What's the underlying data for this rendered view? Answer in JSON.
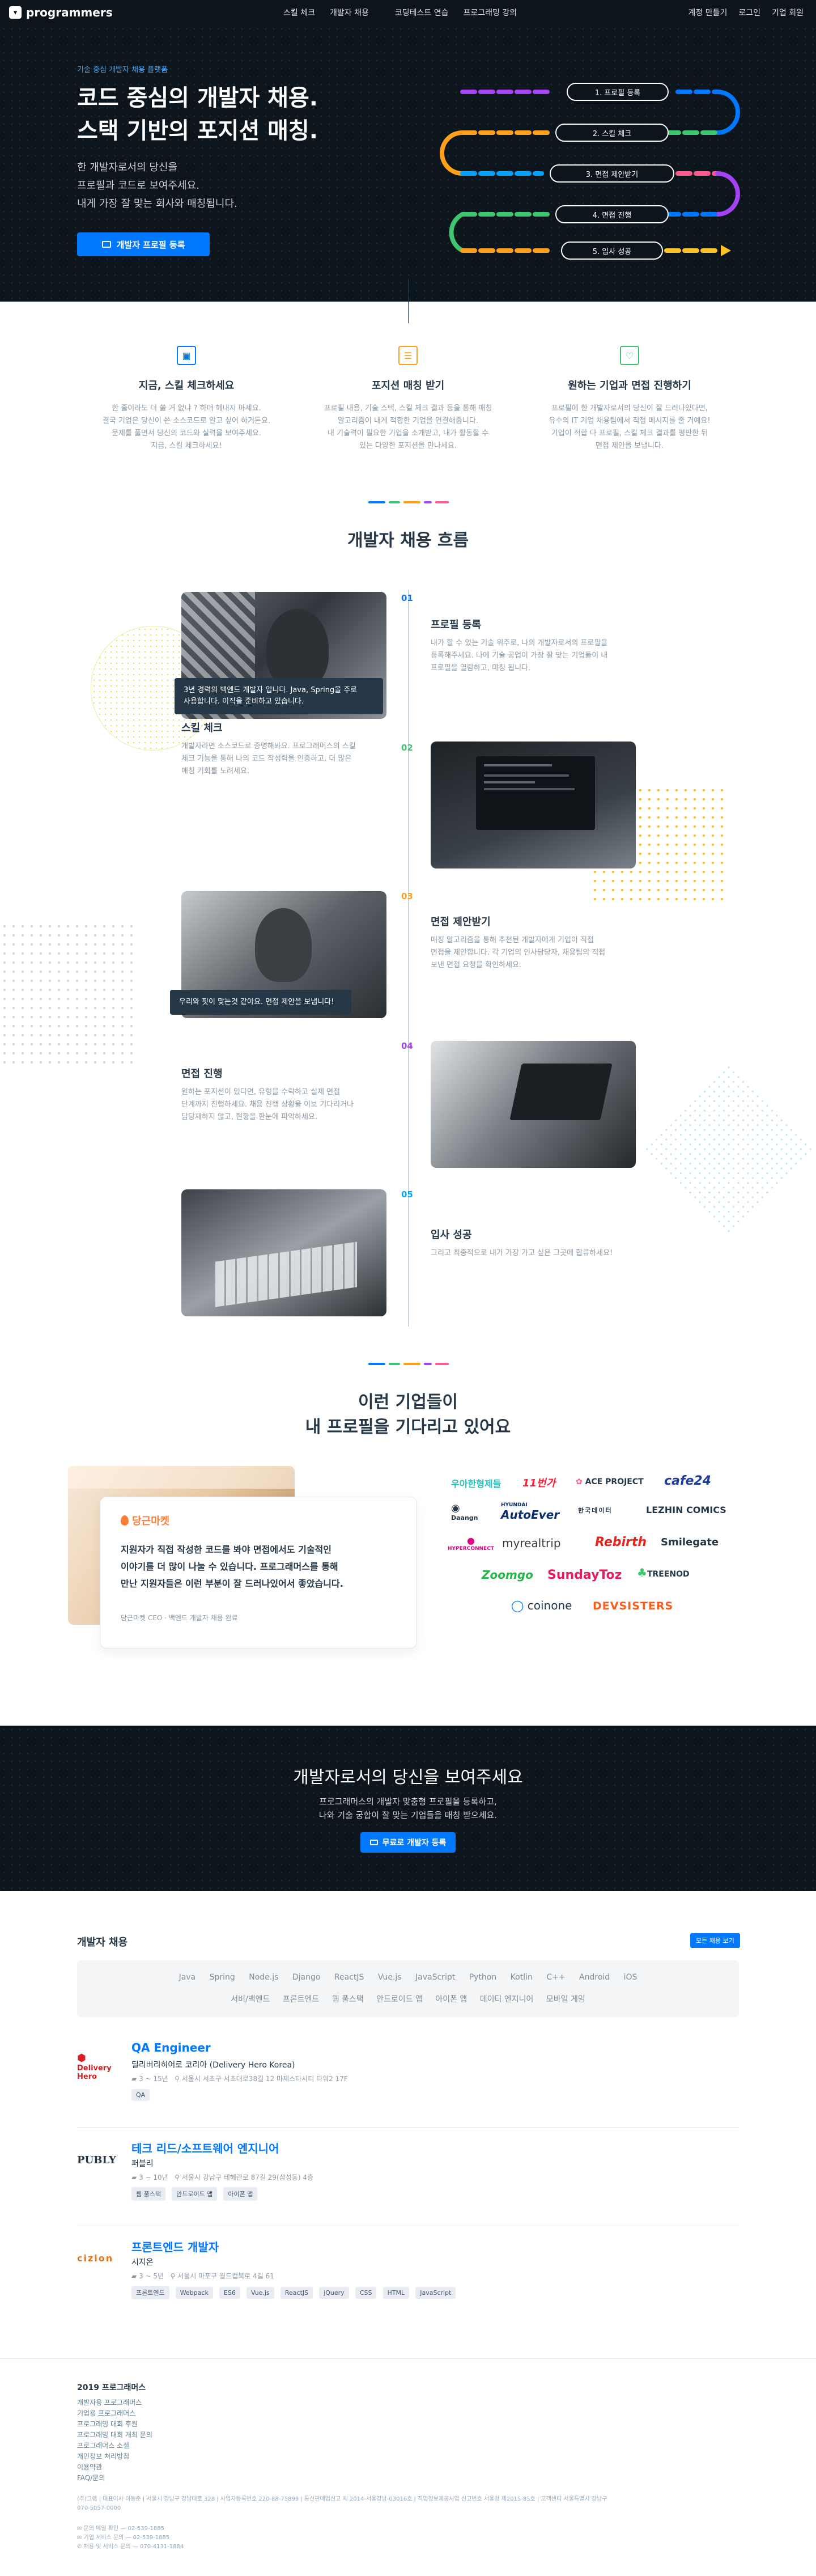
{
  "nav": {
    "brand": "programmers",
    "center_links": [
      "스킬 체크",
      "개발자 채용",
      "코딩테스트 연습",
      "프로그래밍 강의"
    ],
    "right_links": [
      "계정 만들기",
      "로그인",
      "기업 회원"
    ]
  },
  "hero": {
    "eyebrow": "기술 중심 개발자 채용 플랫폼",
    "title_line1": "코드 중심의 개발자 채용.",
    "title_line2": "스택 기반의 포지션 매칭.",
    "desc_line1": "한 개발자로서의 당신을",
    "desc_line2": "프로필과 코드로 보여주세요.",
    "desc_line3": "내게 가장 잘 맞는 회사와 매칭됩니다.",
    "cta": "개발자 프로필 등록",
    "flow_steps": [
      "1. 프로필 등록",
      "2. 스킬 체크",
      "3. 면접 제안받기",
      "4. 면접 진행",
      "5. 입사 성공"
    ]
  },
  "features": [
    {
      "title": "지금, 스킬 체크하세요",
      "icon": "skill-check-icon",
      "color": "#0078ff",
      "lines": [
        "한 줄이라도 더 쓸 거 없냐 ? 하며 헤내지 마세요.",
        "결국 기업은 당신이 쓴 소스코드로 알고 싶어 하거든요.",
        "문제를 풀면서 당신의 코드와 실력을 보여주세요.",
        "지금, 스킬 체크하세요!"
      ]
    },
    {
      "title": "포지션 매칭 받기",
      "icon": "position-match-icon",
      "color": "#ff9f1a",
      "lines": [
        "프로필 내용, 기술 스택, 스킬 체크 결과 등을 통해 매칭",
        "알고리즘이 내게 적합한 기업을 연결해줍니다.",
        "내 기술력이 필요한 기업을 소개받고, 내가 활동할 수",
        "있는 다양한 포지션을 만나세요."
      ]
    },
    {
      "title": "원하는 기업과 면접 진행하기",
      "icon": "interview-icon",
      "color": "#3ec56f",
      "lines": [
        "프로필에 한 개발자로서의 당신이 잘 드러나있다면,",
        "유수의 IT 기업 채용팀에서 직접 메시지를 줄 거예요!",
        "기업이 적합 다 프로필, 스킬 체크 결과를 평판한 뒤",
        "면접 제안을 보냅니다."
      ]
    }
  ],
  "flow_section": {
    "title": "개발자 채용 흐름",
    "steps": [
      {
        "num": "01",
        "title": "프로필 등록",
        "color": "#0078ff",
        "lines": [
          "내가 할 수 있는 기술 위주로, 나의 개발자로서의 프로필을",
          "등록해주세요. 나에 기술 공업이 가장 잘 맞는 기업들이 내",
          "프로필을 열람하고, 먀칭 됩니다."
        ],
        "caption_line1": "3년 경력의 백엔드 개발자 입니다. Java, Spring을 주로",
        "caption_line2": "사용합니다. 이직을 준비하고 있습니다."
      },
      {
        "num": "02",
        "title": "스킬 체크",
        "color": "#3ec56f",
        "lines": [
          "개발자라면 소스코드로 증명해봐요. 프로그래머스의 스킬",
          "체크 기능을 통해 나의 코드 작성력을 인증하고, 더 많은",
          "매칭 기회를 노려세요."
        ]
      },
      {
        "num": "03",
        "title": "면접 제안받기",
        "color": "#ff9f1a",
        "lines": [
          "매칭 알고리즘을 통해 추천된 개발자에게 기업이 직접",
          "면접을 제안합니다. 각 기업의 인사담당자, 채용팀의 직접",
          "보낸 면접 요청을 확인하세요."
        ],
        "caption_line1": "우리와 핏이 맞는것 같아요. 면접 제안을 보냅니다!"
      },
      {
        "num": "04",
        "title": "면접 진행",
        "color": "#a442f4",
        "lines": [
          "원하는 포지션이 있다면, 유형을 수락하고 실제 면접",
          "단계까지 진행하세요. 채용 진행 상황을 이보 기다리거나",
          "담당재하지 않고, 현황을 한눈에 파악하세요."
        ]
      },
      {
        "num": "05",
        "title": "입사 성공",
        "color": "#00a5ff",
        "lines": [
          "그리고 최종적으로 내가 가장 가고 싶은 그곳에 합류하세요!"
        ]
      }
    ]
  },
  "companies_section": {
    "title_line1": "이런 기업들이",
    "title_line2": "내 프로필을 기다리고 있어요",
    "quote_company": "당근마켓",
    "quote_line1": "지원자가 직접 작성한 코드를 봐야 면접에서도 기술적인",
    "quote_line2": "이야기를 더 많이 나눌 수 있습니다. 프로그래머스를 통해",
    "quote_line3": "만난 지원자들은 이런 부분이 잘 드러나있어서 좋았습니다.",
    "quote_author": "당근마켓 CEO  ·  백엔드 개발자 채용 완료",
    "logos": [
      {
        "text": "우아한형제들",
        "color": "#2ac1bc"
      },
      {
        "text": "11번가",
        "color": "#ff1e36"
      },
      {
        "text": "ACE PROJECT",
        "color": "#263747"
      },
      {
        "text": "cafe24",
        "color": "#1d3f99"
      },
      {
        "text": "Daangn",
        "color": "#263747"
      },
      {
        "text": "AutoEver",
        "color": "#0a2d6b"
      },
      {
        "text": "한국데이터",
        "color": "#263747"
      },
      {
        "text": "LEZHIN COMICS",
        "color": "#263747"
      },
      {
        "text": "HYPERCONNECT",
        "color": "#e4007f"
      },
      {
        "text": "myrealtrip",
        "color": "#3a3a3a"
      },
      {
        "text": "Rebirth",
        "color": "#e4231f"
      },
      {
        "text": "Smilegate",
        "color": "#263747"
      },
      {
        "text": "Zoomgo",
        "color": "#25b34a"
      },
      {
        "text": "SundayToz",
        "color": "#e31d5e"
      },
      {
        "text": "TREENOD",
        "color": "#263747"
      },
      {
        "text": "coinone",
        "color": "#263747"
      },
      {
        "text": "DEVSISTERS",
        "color": "#ff5a1a"
      }
    ]
  },
  "cta_band": {
    "title": "개발자로서의 당신을 보여주세요",
    "desc_line1": "프로그래머스의 개발자 맞춤형 프로필을 등록하고,",
    "desc_line2": "나와 기술 궁합이 잘 맞는 기업들을 매칭 받으세요.",
    "button": "무료로 개발자 등록"
  },
  "jobs": {
    "section_title": "개발자 채용",
    "view_all": "모든 채용 보기",
    "filters_row1": [
      "Java",
      "Spring",
      "Node.js",
      "Django",
      "ReactJS",
      "Vue.js",
      "JavaScript",
      "Python",
      "Kotlin",
      "C++",
      "Android",
      "iOS"
    ],
    "filters_row2": [
      "서버/백엔드",
      "프론트엔드",
      "웹 풀스택",
      "안드로이드 앱",
      "아이폰 앱",
      "데이터 엔지니어",
      "모바일 게임"
    ],
    "items": [
      {
        "logo": "Delivery Hero",
        "logo_color": "#d61f26",
        "title": "QA Engineer",
        "company": "딜리버리히어로 코리아 (Delivery Hero Korea)",
        "experience": "3 ~ 15년",
        "location": "서울시 서초구 서초대로38길 12 마제스타시티 타워2 17F",
        "tags": [
          "QA"
        ]
      },
      {
        "logo": "PUBLY",
        "logo_color": "#263747",
        "title": "테크 리드/소프트웨어 엔지니어",
        "company": "퍼블리",
        "experience": "3 ~ 10년",
        "location": "서울시 강남구 테헤란로 87길 29(삼성동) 4층",
        "tags": [
          "웹 풀스택",
          "안드로이드 앱",
          "아이폰 앱"
        ]
      },
      {
        "logo": "cizion",
        "logo_color": "#e8741c",
        "title": "프론트엔드 개발자",
        "company": "시지온",
        "experience": "3 ~ 5년",
        "location": "서울시 마포구 월드컵북로 4길 61",
        "tags": [
          "프론트엔드",
          "Webpack",
          "ES6",
          "Vue.js",
          "ReactJS",
          "jQuery",
          "CSS",
          "HTML",
          "JavaScript"
        ]
      }
    ]
  },
  "footer": {
    "copyright": "2019 프로그래머스",
    "links": [
      "개발자용 프로그래머스",
      "기업용 프로그래머스",
      "프로그래밍 대회 후원",
      "프로그래밍 대회 개최 문의",
      "프로그래머스 소셜",
      "개인정보 처리방침",
      "이용약관",
      "FAQ/문의"
    ],
    "company_info_line1": "(주)그렙 | 대표이사 이동준 | 서울시 강남구 강남대로 328 | 사업자등록번호 220-88-75899 | 통신판매업신고 제 2014-서울강남-03016호 | 직업정보제공사업 신고번호 서울청 제2015-85호 | 고객센터 서울특별시 강남구",
    "company_info_line2": "070-5057-0000",
    "contact_lines": [
      "✉ 문의 메일 확인 — 02-539-1885",
      "✉ 기업 서비스 문의 — 02-539-1885",
      "✆ 채용 및 서비스 문의 — 070-4131-1884"
    ]
  }
}
